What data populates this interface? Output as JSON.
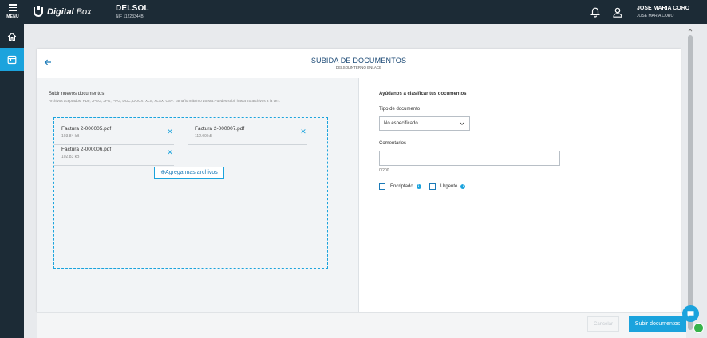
{
  "app": {
    "menu_label": "MENÚ",
    "logo_brand": "Digital",
    "logo_product": "Box",
    "company_name": "DELSOL",
    "company_nif": "NIF 11223344B",
    "user_name": "JOSE MARIA CORO",
    "user_sub": "JOSE MARIA CORO"
  },
  "rail": [
    {
      "icon": "home-icon"
    },
    {
      "icon": "documents-icon",
      "active": true
    }
  ],
  "page": {
    "title": "SUBIDA DE DOCUMENTOS",
    "subtitle": "DELSOLINTERNO ENLACE"
  },
  "upload": {
    "title": "Subir nuevos documentos",
    "hint": "Archivos aceptados: PDF, JPEG, JPG, PNG, DOC, DOCX, XLS, XLSX, CSV. Tamaño máximo 16 MB.Puedes subir hasta 20 archivos a la vez.",
    "files": [
      {
        "name": "Factura 2-000005.pdf",
        "size": "103.84 kB"
      },
      {
        "name": "Factura 2-000007.pdf",
        "size": "112.09 kB"
      },
      {
        "name": "Factura 2-000006.pdf",
        "size": "102.83 kB"
      }
    ],
    "remove_glyph": "✕",
    "add_label": "⊕Agrega mas archivos"
  },
  "classify": {
    "title": "Ayúdanos a clasificar tus documentos",
    "doc_type_label": "Tipo de documento",
    "doc_type_value": "No especificado",
    "comments_label": "Comentarios",
    "counter": "0/200",
    "encrypted_label": "Encriptado",
    "urgent_label": "Urgente",
    "info_glyph": "i"
  },
  "actions": {
    "cancel_label": "Cancelar",
    "submit_label": "Subir documentos"
  },
  "colors": {
    "topbar": "#1c2b36",
    "accent": "#1ba3dd",
    "title_blue": "#1c4a76",
    "online": "#37b34a"
  }
}
